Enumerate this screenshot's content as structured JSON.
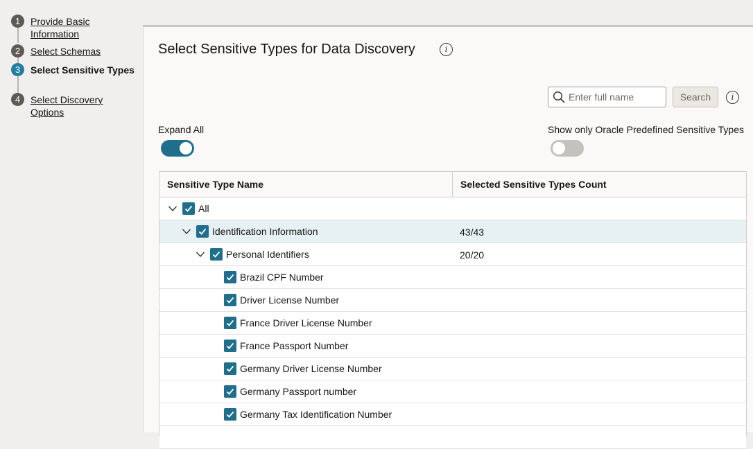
{
  "train": {
    "steps": [
      {
        "number": "1",
        "label": "Provide Basic Information",
        "current": false
      },
      {
        "number": "2",
        "label": "Select Schemas",
        "current": false
      },
      {
        "number": "3",
        "label": "Select Sensitive Types",
        "current": true
      },
      {
        "number": "4",
        "label": "Select Discovery Options",
        "current": false
      }
    ]
  },
  "page": {
    "title": "Select Sensitive Types for Data Discovery",
    "info_icon": "info-icon"
  },
  "search": {
    "placeholder": "Enter full name",
    "value": "",
    "button_label": "Search"
  },
  "toggles": {
    "expand_all": {
      "label": "Expand All",
      "on": true
    },
    "oracle_predefined": {
      "label": "Show only Oracle Predefined Sensitive Types",
      "on": false
    }
  },
  "table": {
    "headers": [
      "Sensitive Type Name",
      "Selected Sensitive Types Count"
    ],
    "rows": [
      {
        "label": "All",
        "count": "",
        "level": 0,
        "expandable": true,
        "checked": true,
        "selected": false
      },
      {
        "label": "Identification Information",
        "count": "43/43",
        "level": 1,
        "expandable": true,
        "checked": true,
        "selected": true
      },
      {
        "label": "Personal Identifiers",
        "count": "20/20",
        "level": 2,
        "expandable": true,
        "checked": true,
        "selected": false
      },
      {
        "label": "Brazil CPF Number",
        "count": "",
        "level": 3,
        "expandable": false,
        "checked": true,
        "selected": false
      },
      {
        "label": "Driver License Number",
        "count": "",
        "level": 3,
        "expandable": false,
        "checked": true,
        "selected": false
      },
      {
        "label": "France Driver License Number",
        "count": "",
        "level": 3,
        "expandable": false,
        "checked": true,
        "selected": false
      },
      {
        "label": "France Passport Number",
        "count": "",
        "level": 3,
        "expandable": false,
        "checked": true,
        "selected": false
      },
      {
        "label": "Germany Driver License Number",
        "count": "",
        "level": 3,
        "expandable": false,
        "checked": true,
        "selected": false
      },
      {
        "label": "Germany Passport number",
        "count": "",
        "level": 3,
        "expandable": false,
        "checked": true,
        "selected": false
      },
      {
        "label": "Germany Tax Identification Number",
        "count": "",
        "level": 3,
        "expandable": false,
        "checked": true,
        "selected": false
      },
      {
        "label": "",
        "count": "",
        "level": 3,
        "expandable": false,
        "checked": false,
        "selected": false
      }
    ]
  },
  "colors": {
    "accent": "#1e6e8c",
    "current_step": "#227e9e",
    "selected_row": "#e7f1f4"
  }
}
